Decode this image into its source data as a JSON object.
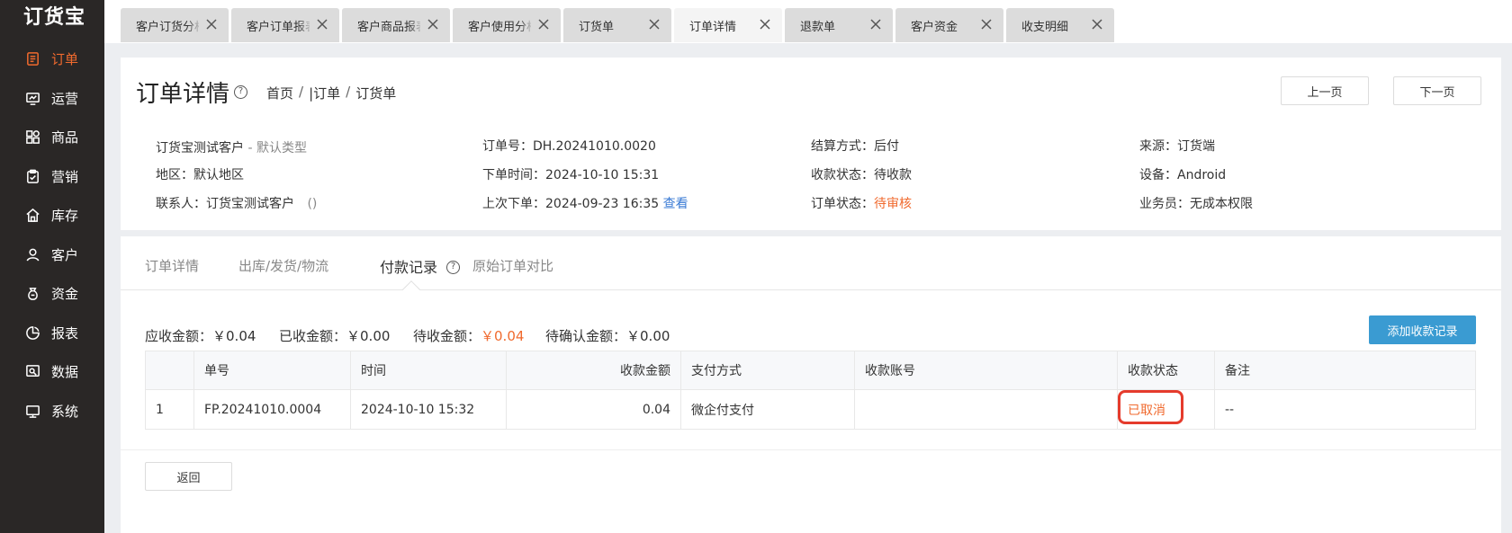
{
  "app": {
    "logo": "订货宝"
  },
  "sidebar": {
    "items": [
      {
        "label": "订单",
        "icon": "order-icon",
        "active": true
      },
      {
        "label": "运营",
        "icon": "operation-icon",
        "active": false
      },
      {
        "label": "商品",
        "icon": "product-icon",
        "active": false
      },
      {
        "label": "营销",
        "icon": "marketing-icon",
        "active": false
      },
      {
        "label": "库存",
        "icon": "inventory-icon",
        "active": false
      },
      {
        "label": "客户",
        "icon": "customer-icon",
        "active": false
      },
      {
        "label": "资金",
        "icon": "funds-icon",
        "active": false
      },
      {
        "label": "报表",
        "icon": "report-icon",
        "active": false
      },
      {
        "label": "数据",
        "icon": "data-icon",
        "active": false
      },
      {
        "label": "系统",
        "icon": "system-icon",
        "active": false
      }
    ]
  },
  "tabs": [
    {
      "label": "客户订货分析",
      "active": false
    },
    {
      "label": "客户订单报表",
      "active": false
    },
    {
      "label": "客户商品报表",
      "active": false
    },
    {
      "label": "客户使用分析",
      "active": false
    },
    {
      "label": "订货单",
      "active": false
    },
    {
      "label": "订单详情",
      "active": true
    },
    {
      "label": "退款单",
      "active": false
    },
    {
      "label": "客户资金",
      "active": false
    },
    {
      "label": "收支明细",
      "active": false
    }
  ],
  "header": {
    "title": "订单详情",
    "breadcrumb": [
      "首页",
      "|订单",
      "订货单"
    ],
    "prev_label": "上一页",
    "next_label": "下一页"
  },
  "order": {
    "customer": "订货宝测试客户",
    "customer_type": "- 默认类型",
    "region_label": "地区：",
    "region": "默认地区",
    "contact_label": "联系人：",
    "contact": "订货宝测试客户",
    "contact_phone": "()",
    "order_no_label": "订单号：",
    "order_no": "DH.20241010.0020",
    "order_time_label": "下单时间：",
    "order_time": "2024-10-10 15:31",
    "last_order_label": "上次下单：",
    "last_order": "2024-09-23 16:35",
    "view_link": "查看",
    "settlement_label": "结算方式：",
    "settlement": "后付",
    "payment_status_label": "收款状态：",
    "payment_status": "待收款",
    "order_status_label": "订单状态：",
    "order_status": "待审核",
    "source_label": "来源：",
    "source": "订货端",
    "device_label": "设备：",
    "device": "Android",
    "salesman_label": "业务员：",
    "salesman": "无成本权限"
  },
  "subtabs": [
    {
      "label": "订单详情",
      "active": false
    },
    {
      "label": "出库/发货/物流",
      "active": false
    },
    {
      "label": "付款记录",
      "active": true
    },
    {
      "label": "原始订单对比",
      "active": false
    }
  ],
  "summary": {
    "receivable_label": "应收金额：",
    "receivable": "￥0.04",
    "received_label": "已收金额：",
    "received": "￥0.00",
    "pending_label": "待收金额：",
    "pending": "￥0.04",
    "unconfirmed_label": "待确认金额：",
    "unconfirmed": "￥0.00",
    "add_button": "添加收款记录"
  },
  "table": {
    "headers": [
      "",
      "单号",
      "时间",
      "收款金额",
      "支付方式",
      "收款账号",
      "收款状态",
      "备注"
    ],
    "rows": [
      {
        "index": "1",
        "no": "FP.20241010.0004",
        "time": "2024-10-10 15:32",
        "amount": "0.04",
        "method": "微企付支付",
        "account": "",
        "status": "已取消",
        "remark": "--"
      }
    ]
  },
  "footer": {
    "back_label": "返回"
  },
  "colors": {
    "accent": "#f06a2e",
    "primary_button": "#3a9bd2",
    "sidebar_bg": "#2a2726",
    "highlight": "#e53b2c"
  }
}
